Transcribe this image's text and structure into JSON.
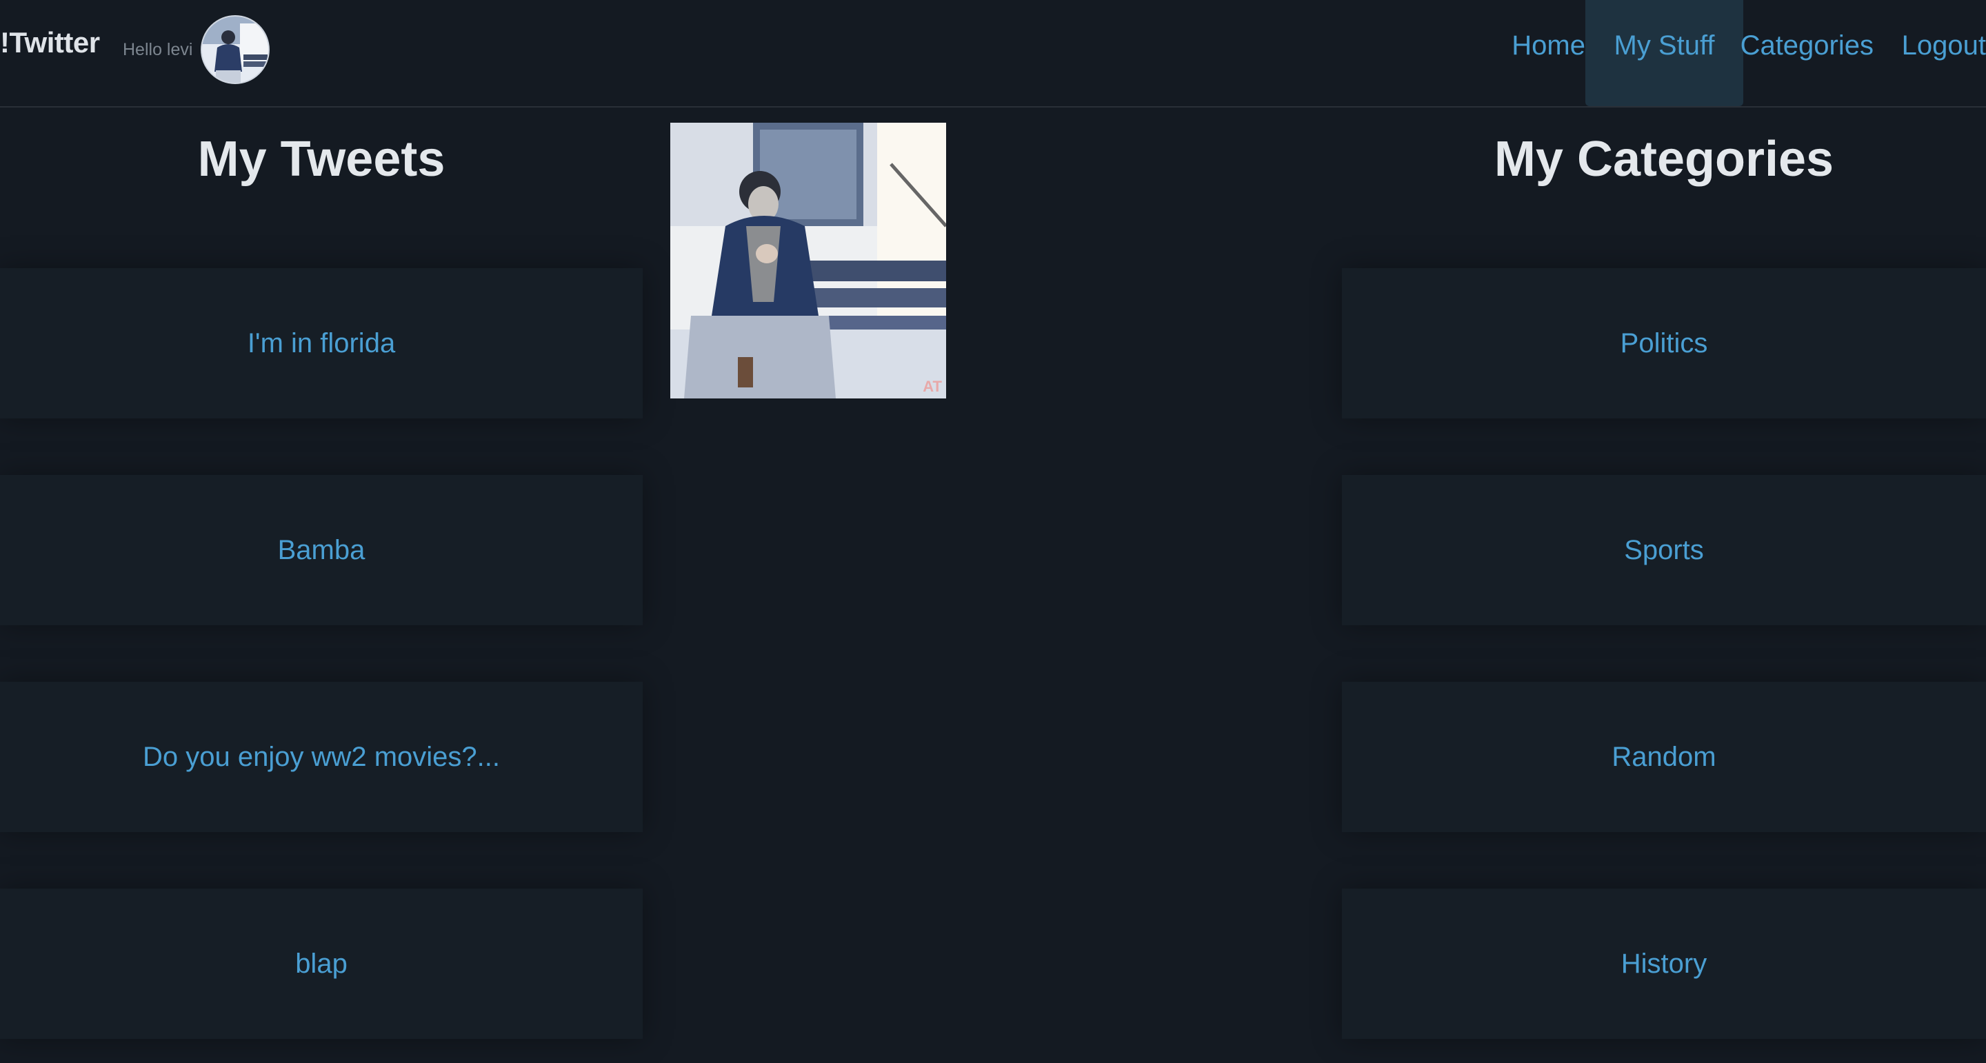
{
  "header": {
    "brand": "!Twitter",
    "greeting": "Hello levi",
    "avatar_icon": "user-avatar-photo",
    "nav": {
      "home": "Home",
      "my_stuff": "My Stuff",
      "categories": "Categories",
      "logout": "Logout"
    },
    "active_nav": "My Stuff"
  },
  "tweets": {
    "title": "My Tweets",
    "items": [
      "I'm in florida",
      "Bamba",
      "Do you enjoy ww2 movies?...",
      "blap"
    ]
  },
  "profile_photo": {
    "icon": "profile-photo",
    "watermark": "AT"
  },
  "categories": {
    "title": "My Categories",
    "items": [
      "Politics",
      "Sports",
      "Random",
      "History"
    ]
  },
  "colors": {
    "background": "#141a22",
    "accent": "#4a9fd3",
    "card": "#161e26",
    "active_nav": "#1e3240"
  }
}
